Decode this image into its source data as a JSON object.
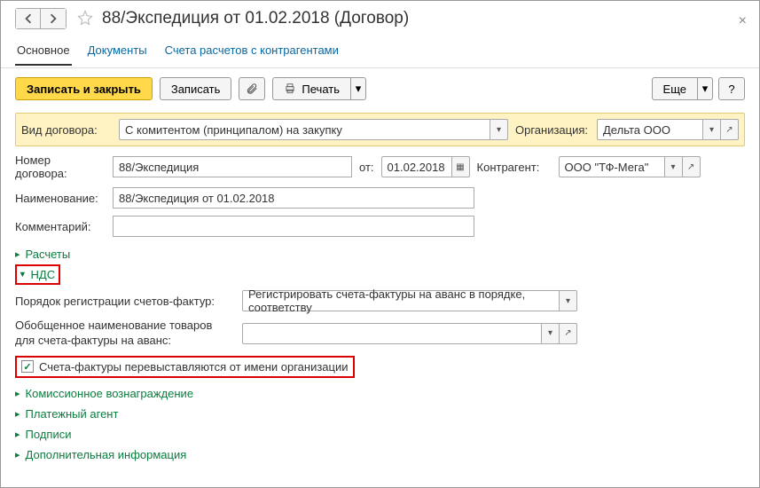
{
  "header": {
    "title": "88/Экспедиция от 01.02.2018 (Договор)"
  },
  "tabs": {
    "main": "Основное",
    "docs": "Документы",
    "accounts": "Счета расчетов с контрагентами"
  },
  "toolbar": {
    "save_close": "Записать и закрыть",
    "save": "Записать",
    "print": "Печать",
    "more": "Еще",
    "help": "?"
  },
  "form": {
    "contract_type_label": "Вид договора:",
    "contract_type": "С комитентом (принципалом) на закупку",
    "org_label": "Организация:",
    "org": "Дельта ООО",
    "number_label": "Номер договора:",
    "number": "88/Экспедиция",
    "date_label": "от:",
    "date": "01.02.2018",
    "party_label": "Контрагент:",
    "party": "ООО \"ТФ-Мега\"",
    "name_label": "Наименование:",
    "name": "88/Экспедиция от 01.02.2018",
    "comment_label": "Комментарий:",
    "comment": ""
  },
  "sections": {
    "calc": "Расчеты",
    "vat": "НДС",
    "sf_order_label": "Порядок регистрации счетов-фактур:",
    "sf_order": "Регистрировать счета-фактуры на аванс в порядке, соответству",
    "generic_name_label": "Обобщенное наименование товаров для счета-фактуры на аванс:",
    "generic_name": "",
    "reissue": "Счета-фактуры перевыставляются от имени организации",
    "commission": "Комиссионное вознаграждение",
    "agent": "Платежный агент",
    "sign": "Подписи",
    "extra": "Дополнительная информация"
  }
}
